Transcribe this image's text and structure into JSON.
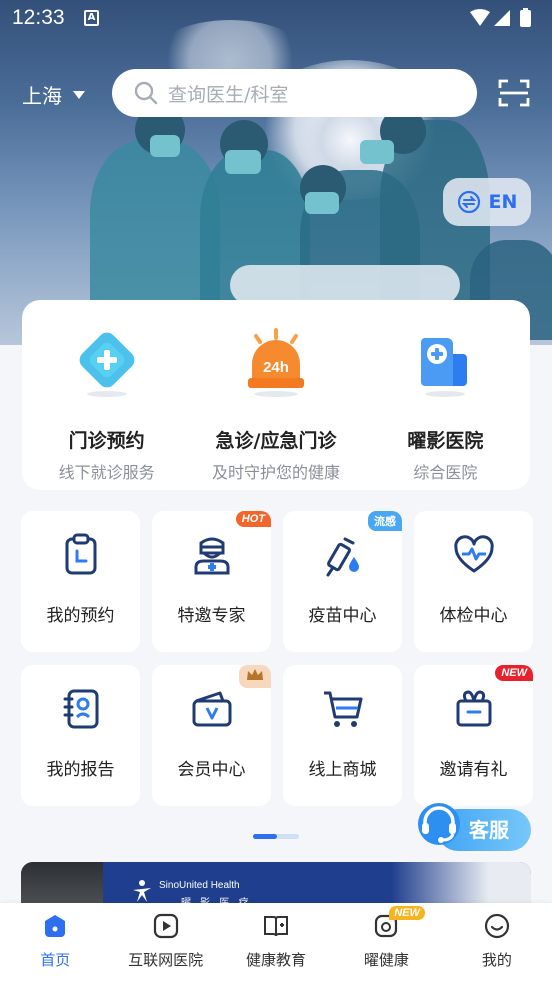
{
  "status_bar": {
    "time": "12:33",
    "notification_glyph": "A"
  },
  "header": {
    "city": "上海",
    "search_placeholder": "查询医生/科室",
    "language_toggle": "EN"
  },
  "main_services": [
    {
      "title": "门诊预约",
      "subtitle": "线下就诊服务",
      "icon": "plus-diamond-icon"
    },
    {
      "title": "急诊/应急门诊",
      "subtitle": "及时守护您的健康",
      "icon": "alarm-24h-icon",
      "icon_text": "24h"
    },
    {
      "title": "曜影医院",
      "subtitle": "综合医院",
      "icon": "hospital-building-icon"
    }
  ],
  "grid_items": [
    {
      "label": "我的预约",
      "icon": "clipboard-clock-icon"
    },
    {
      "label": "特邀专家",
      "icon": "doctor-icon",
      "badge": "HOT",
      "badge_color": "#f2662b"
    },
    {
      "label": "疫苗中心",
      "icon": "syringe-icon",
      "badge": "流感",
      "badge_color": "#4aa7f3"
    },
    {
      "label": "体检中心",
      "icon": "heart-pulse-icon"
    },
    {
      "label": "我的报告",
      "icon": "report-icon"
    },
    {
      "label": "会员中心",
      "icon": "vip-card-icon",
      "badge_icon": "crown-icon",
      "badge_color": "#f7d8bd"
    },
    {
      "label": "线上商城",
      "icon": "cart-icon"
    },
    {
      "label": "邀请有礼",
      "icon": "gift-icon",
      "badge": "NEW",
      "badge_color": "#e8222d"
    }
  ],
  "customer_service": {
    "label": "客服"
  },
  "banner": {
    "brand_en": "SinoUnited Health",
    "brand_cn": "曜 影 医 疗"
  },
  "tabbar": [
    {
      "label": "首页",
      "icon": "home-icon",
      "active": true
    },
    {
      "label": "互联网医院",
      "icon": "video-play-icon"
    },
    {
      "label": "健康教育",
      "icon": "book-icon"
    },
    {
      "label": "曜健康",
      "icon": "health-badge-icon",
      "badge": "NEW"
    },
    {
      "label": "我的",
      "icon": "profile-smile-icon"
    }
  ],
  "colors": {
    "primary": "#2d6ff0",
    "icon_navy": "#1f3b73",
    "background": "#f4f6fa"
  }
}
